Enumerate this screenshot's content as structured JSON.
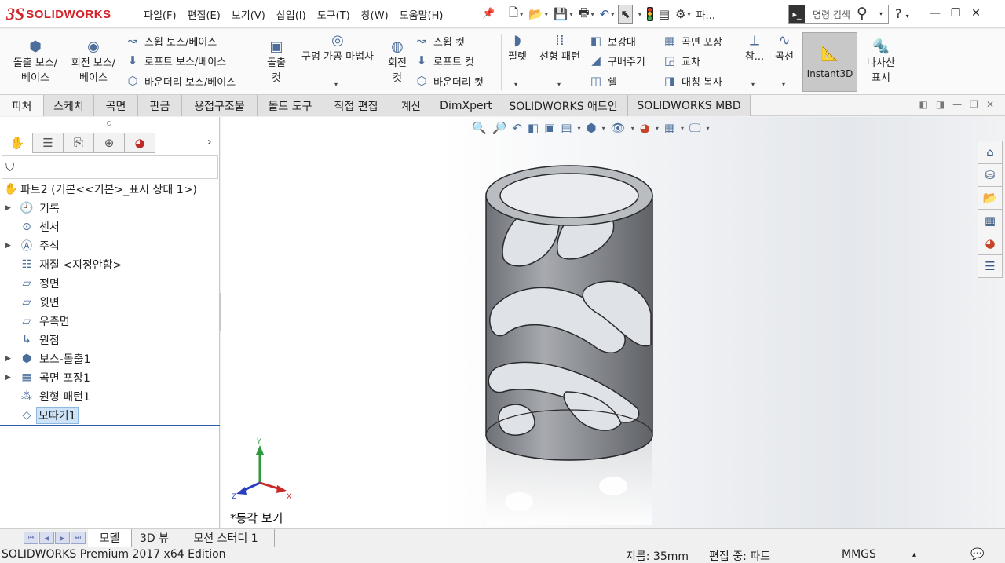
{
  "app": {
    "logo_mark": "3S",
    "logo_text": "SOLIDWORKS"
  },
  "menu": [
    "파일(F)",
    "편집(E)",
    "보기(V)",
    "삽입(I)",
    "도구(T)",
    "창(W)",
    "도움말(H)"
  ],
  "quick_access": {
    "file_tab_text": "파...",
    "search_placeholder": "명령 검색",
    "help_label": "?"
  },
  "ribbon": {
    "extrude_boss": [
      "돌출 보스/",
      "베이스"
    ],
    "revolve_boss": [
      "회전 보스/",
      "베이스"
    ],
    "sweep_boss": "스윕 보스/베이스",
    "loft_boss": "로프트 보스/베이스",
    "boundary_boss": "바운더리 보스/베이스",
    "extrude_cut": [
      "돌출",
      "컷"
    ],
    "hole_wizard": "구멍 가공 마법사",
    "revolve_cut": [
      "회전",
      "컷"
    ],
    "sweep_cut": "스윕 컷",
    "loft_cut": "로프트 컷",
    "boundary_cut": "바운더리 컷",
    "fillet": "필렛",
    "linear_pattern": "선형 패턴",
    "rib": "보강대",
    "draft": "구배주기",
    "shell": "쉘",
    "wrap": "곡면 포장",
    "intersect": "교차",
    "mirror": "대칭 복사",
    "reference": "참...",
    "curves": "곡선",
    "instant3d": "Instant3D",
    "cosmetic_thread": [
      "나사산",
      "표시"
    ]
  },
  "command_tabs": [
    {
      "label": "피처",
      "active": true
    },
    {
      "label": "스케치",
      "active": false
    },
    {
      "label": "곡면",
      "active": false
    },
    {
      "label": "판금",
      "active": false
    },
    {
      "label": "용접구조물",
      "active": false
    },
    {
      "label": "몰드 도구",
      "active": false
    },
    {
      "label": "직접 편집",
      "active": false
    },
    {
      "label": "계산",
      "active": false
    },
    {
      "label": "DimXpert",
      "active": false
    },
    {
      "label": "SOLIDWORKS 애드인",
      "active": false
    },
    {
      "label": "SOLIDWORKS MBD",
      "active": false
    }
  ],
  "feature_tree": {
    "root": "파트2  (기본<<기본>_표시 상태 1>)",
    "items": [
      {
        "label": "기록",
        "expandable": true,
        "icon": "history-icon"
      },
      {
        "label": "센서",
        "expandable": false,
        "icon": "sensor-icon"
      },
      {
        "label": "주석",
        "expandable": true,
        "icon": "annotation-icon"
      },
      {
        "label": "재질 <지정안함>",
        "expandable": false,
        "icon": "material-icon"
      },
      {
        "label": "정면",
        "expandable": false,
        "icon": "plane-icon"
      },
      {
        "label": "윗면",
        "expandable": false,
        "icon": "plane-icon"
      },
      {
        "label": "우측면",
        "expandable": false,
        "icon": "plane-icon"
      },
      {
        "label": "원점",
        "expandable": false,
        "icon": "origin-icon"
      },
      {
        "label": "보스-돌출1",
        "expandable": true,
        "icon": "extrude-icon"
      },
      {
        "label": "곡면 포장1",
        "expandable": true,
        "icon": "wrap-icon"
      },
      {
        "label": "원형 패턴1",
        "expandable": false,
        "icon": "circular-pattern-icon"
      },
      {
        "label": "모따기1",
        "expandable": false,
        "icon": "chamfer-icon",
        "selected": true
      }
    ]
  },
  "viewport": {
    "view_name": "*등각 보기",
    "triad": {
      "x": "X",
      "y": "Y",
      "z": "Z"
    }
  },
  "bottom_tabs": [
    {
      "label": "모델",
      "active": true
    },
    {
      "label": "3D 뷰",
      "active": false
    },
    {
      "label": "모션 스터디 1",
      "active": false
    }
  ],
  "status_bar": {
    "edition": "SOLIDWORKS Premium 2017 x64 Edition",
    "diameter": "지름: 35mm",
    "editing": "편집 중: 파트",
    "units": "MMGS",
    "units_dd": "▴"
  },
  "colors": {
    "brand_red": "#d2232a",
    "selection_blue": "#cde3f8",
    "model_gray": "#8e9196"
  }
}
